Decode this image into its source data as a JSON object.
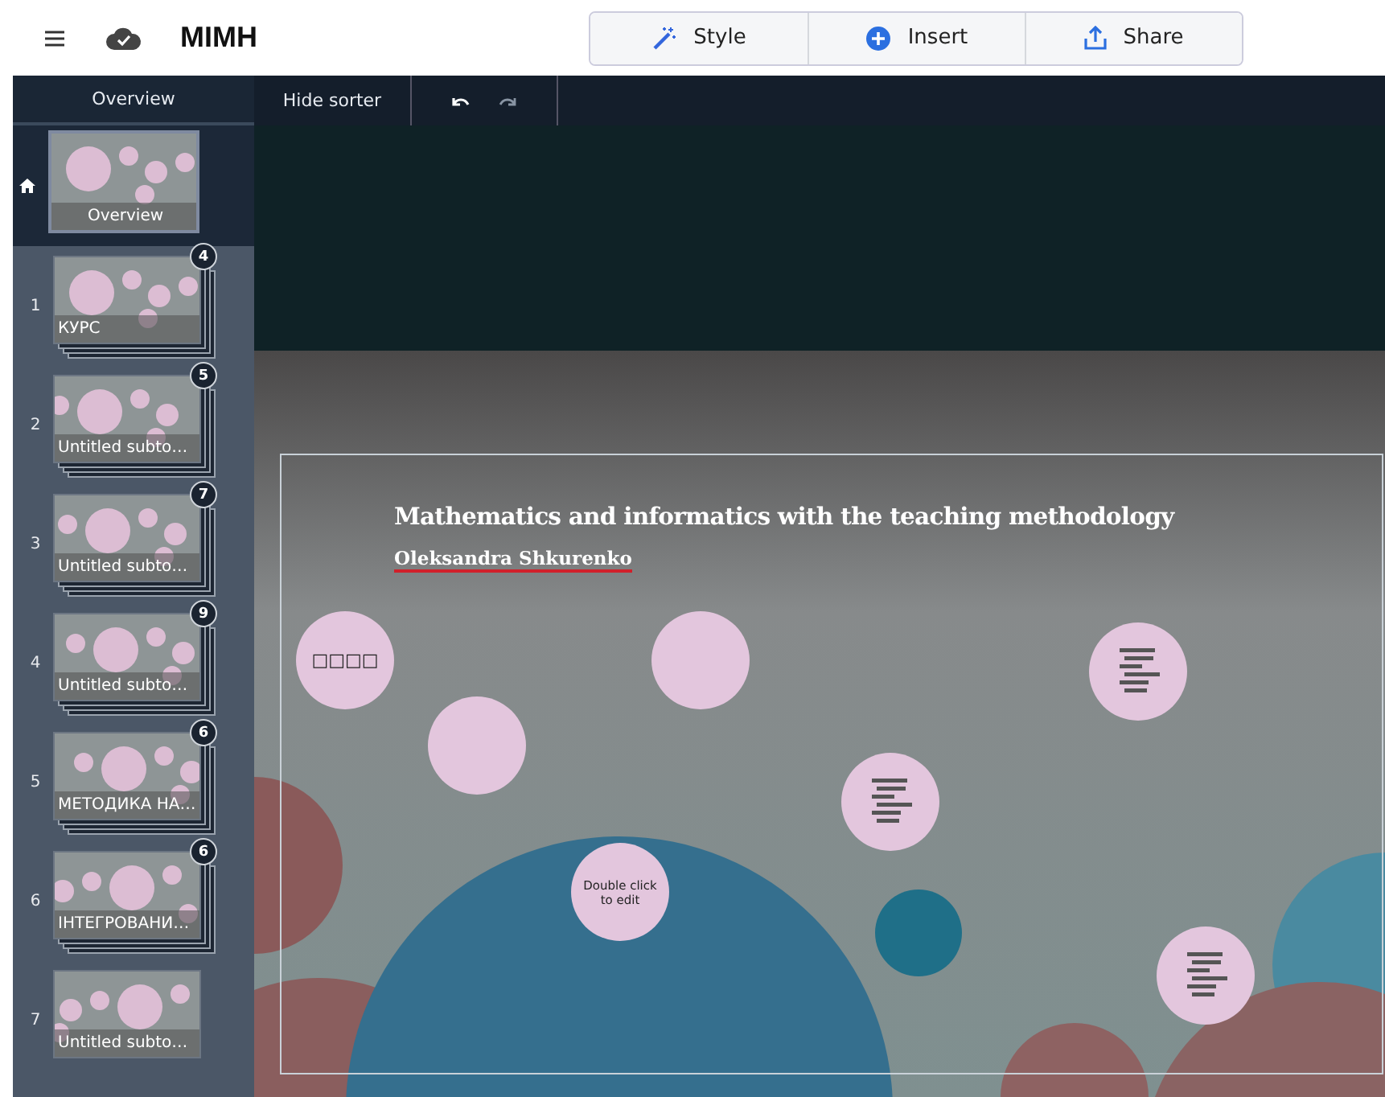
{
  "header": {
    "title": "MIMH",
    "actions": [
      {
        "label": "Style",
        "kind": "style"
      },
      {
        "label": "Insert",
        "kind": "insert"
      },
      {
        "label": "Share",
        "kind": "share"
      }
    ]
  },
  "sorter": {
    "title": "Overview",
    "hide_label": "Hide sorter"
  },
  "overview": {
    "label": "Overview",
    "selected": true
  },
  "slides": [
    {
      "number": "1",
      "label": "КУРС",
      "count": "4",
      "selected": false
    },
    {
      "number": "2",
      "label": "Untitled subto…",
      "count": "5",
      "selected": false
    },
    {
      "number": "3",
      "label": "Untitled subto…",
      "count": "7",
      "selected": false
    },
    {
      "number": "4",
      "label": "Untitled subto…",
      "count": "9",
      "selected": false
    },
    {
      "number": "5",
      "label": "МЕТОДИКА НА…",
      "count": "6",
      "selected": false
    },
    {
      "number": "6",
      "label": "ІНТЕГРОВАНИ…",
      "count": "6",
      "selected": false
    },
    {
      "number": "7",
      "label": "Untitled subto…",
      "selected": false
    }
  ],
  "canvas": {
    "title": "Mathematics and informatics with the teaching methodology",
    "author": "Oleksandra Shkurenko",
    "circles": [
      {
        "kind": "text",
        "text": "□□□□"
      },
      {
        "kind": "empty"
      },
      {
        "kind": "empty"
      },
      {
        "kind": "picture"
      },
      {
        "kind": "picture"
      },
      {
        "kind": "note",
        "text": "Double click to edit"
      },
      {
        "kind": "picture"
      }
    ]
  }
}
